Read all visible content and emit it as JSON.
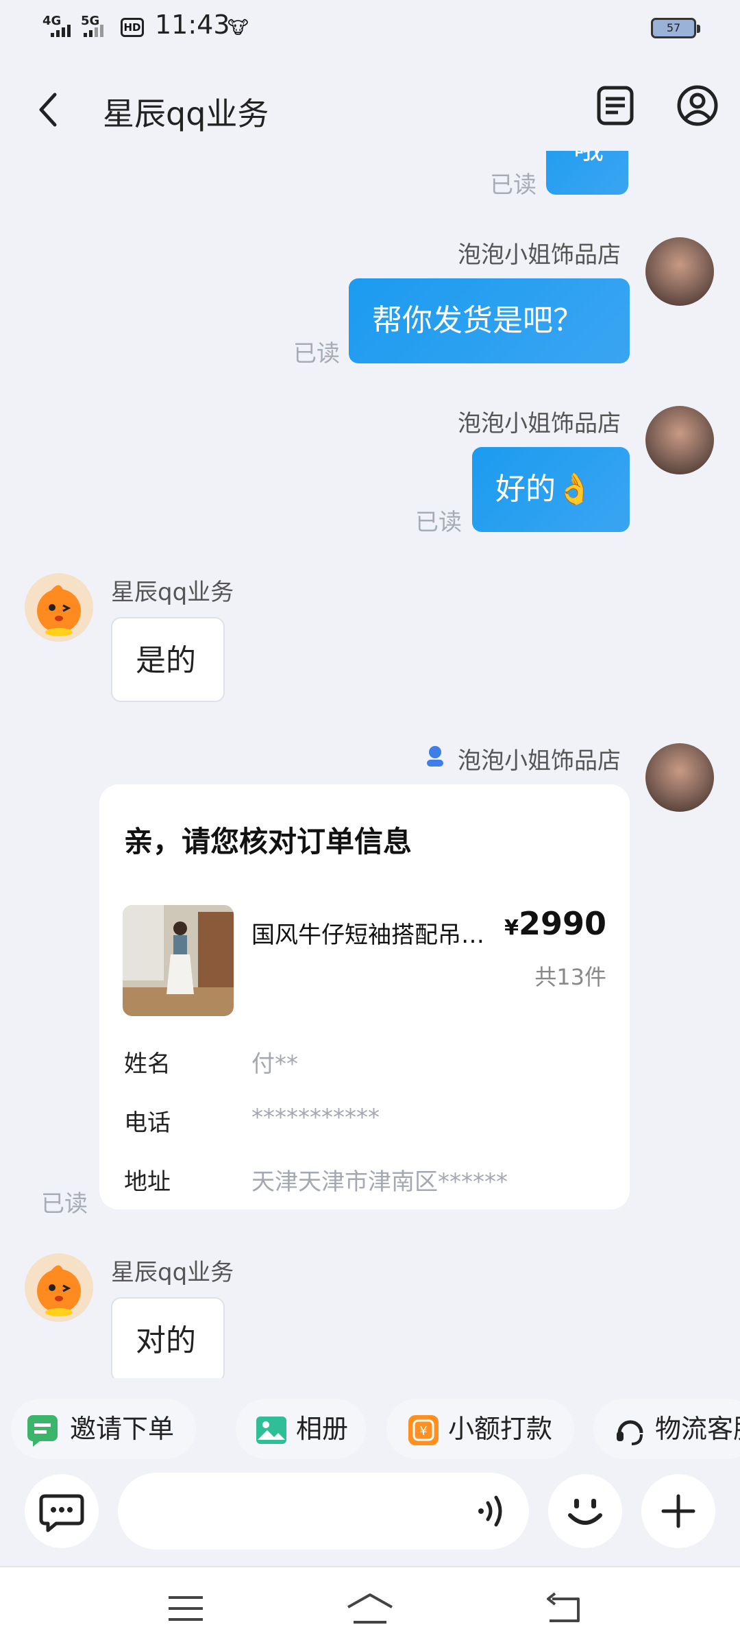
{
  "status_bar": {
    "net1": "4G",
    "net2": "5G",
    "hd": "HD",
    "time": "11:43",
    "battery": "57"
  },
  "header": {
    "title": "星辰qq业务"
  },
  "messages": {
    "m0": {
      "text": "哦",
      "read": "已读"
    },
    "m1": {
      "sender": "泡泡小姐饰品店",
      "text": "帮你发货是吧？",
      "read": "已读"
    },
    "m2": {
      "sender": "泡泡小姐饰品店",
      "text": "好的👌",
      "read": "已读"
    },
    "m3": {
      "sender": "星辰qq业务",
      "text": "是的"
    },
    "m4": {
      "sender": "泡泡小姐饰品店",
      "read": "已读"
    },
    "m5": {
      "sender": "星辰qq业务",
      "text": "对的"
    }
  },
  "order": {
    "title": "亲，请您核对订单信息",
    "product_name": "国风牛仔短袖搭配吊…",
    "currency": "¥",
    "price": "2990",
    "quantity": "共13件",
    "name_label": "姓名",
    "name_value": "付**",
    "phone_label": "电话",
    "phone_value": "***********",
    "address_label": "地址",
    "address_value": "天津天津市津南区******"
  },
  "quick_actions": [
    "邀请下单",
    "相册",
    "小额打款",
    "物流客服"
  ],
  "colors": {
    "accent": "#1b9bf0",
    "bg": "#f0f2f7"
  }
}
